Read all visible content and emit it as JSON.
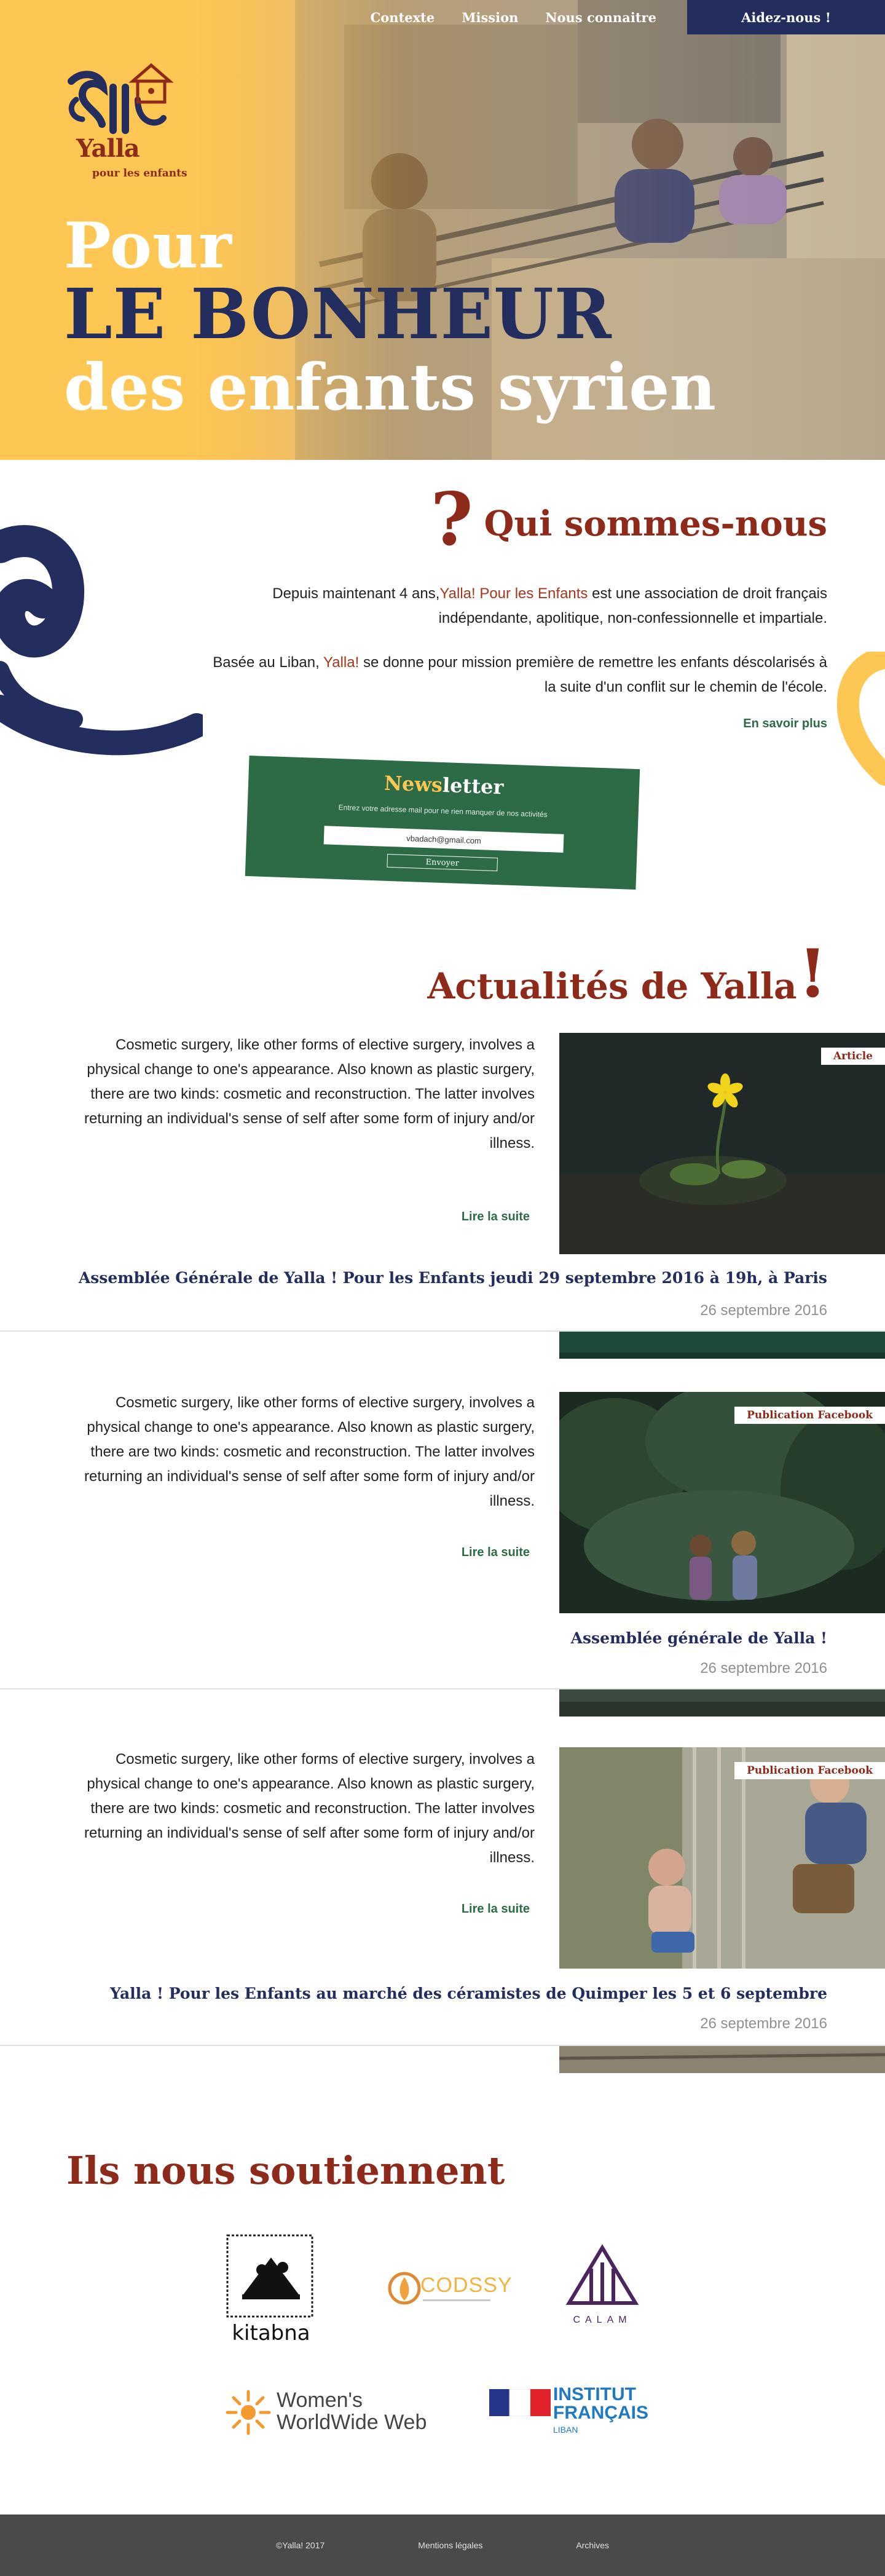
{
  "nav": {
    "items": [
      "Contexte",
      "Mission",
      "Nous connaitre"
    ],
    "cta": "Aidez-nous !"
  },
  "logo": {
    "name": "Yalla",
    "subtitle": "pour les enfants"
  },
  "hero": {
    "line1": "Pour",
    "line2": "LE BONHEUR",
    "line3": "des enfants syrien"
  },
  "about": {
    "title": "Qui sommes-nous",
    "title_mark": "?",
    "p1_before": "Depuis maintenant 4 ans,",
    "p1_highlight": "Yalla! Pour les Enfants",
    "p1_after": " est une association de droit français indépendante, apolitique, non-confessionnelle et impartiale.",
    "p2_before": "Basée au Liban, ",
    "p2_highlight": "Yalla!",
    "p2_after": " se donne pour mission première de remettre les enfants déscolarisés à la suite d'un conflit sur le chemin de l'école.",
    "more": "En savoir plus"
  },
  "newsletter": {
    "title_a": "News",
    "title_b": "letter",
    "description": "Entrez votre adresse mail pour ne rien manquer de nos activités",
    "input_value": "vbadach@gmail.com",
    "button": "Envoyer"
  },
  "news": {
    "title": "Actualités de Yalla",
    "title_mark": "!",
    "read_more": "Lire la suite",
    "articles": [
      {
        "excerpt": "Cosmetic surgery, like other forms of elective surgery, involves a physical change to one's appearance. Also known as plastic surgery, there are two kinds: cosmetic and reconstruction. The latter involves returning an individual's sense of self after some form of injury and/or illness.",
        "tag": "Article",
        "headline": "Assemblée Générale de Yalla ! Pour les Enfants jeudi 29 septembre 2016 à 19h, à Paris",
        "date": "26 septembre 2016"
      },
      {
        "excerpt": "Cosmetic surgery, like other forms of elective surgery, involves a physical change to one's appearance. Also known as plastic surgery, there are two kinds: cosmetic and reconstruction. The latter involves returning an individual's sense of self after some form of injury and/or illness.",
        "tag": "Publication Facebook",
        "headline": "Assemblée générale de Yalla !",
        "date": "26 septembre 2016"
      },
      {
        "excerpt": "Cosmetic surgery, like other forms of elective surgery, involves a physical change to one's appearance. Also known as plastic surgery, there are two kinds: cosmetic and reconstruction. The latter involves returning an individual's sense of self after some form of injury and/or illness.",
        "tag": "Publication Facebook",
        "headline": "Yalla ! Pour les Enfants au marché des céramistes de Quimper les 5 et 6 septembre",
        "date": "26 septembre 2016"
      }
    ]
  },
  "supporters": {
    "title": "Ils nous soutiennent",
    "logos": {
      "kitabna": "kitabna",
      "codssy": "CODSSY",
      "calam": "CALAM",
      "wwwb_line1": "Women's",
      "wwwb_line2": "WorldWide Web",
      "if_line1": "INSTITUT",
      "if_line2": "FRANÇAIS",
      "if_line3": "LIBAN"
    }
  },
  "footer": {
    "copyright": "©Yalla! 2017",
    "legal": "Mentions légales",
    "archives": "Archives"
  },
  "colors": {
    "brand_red": "#8e2a1a",
    "navy": "#232d5e",
    "yellow": "#fec653",
    "green": "#2c6b45",
    "footer_gray": "#4a4a4a"
  }
}
